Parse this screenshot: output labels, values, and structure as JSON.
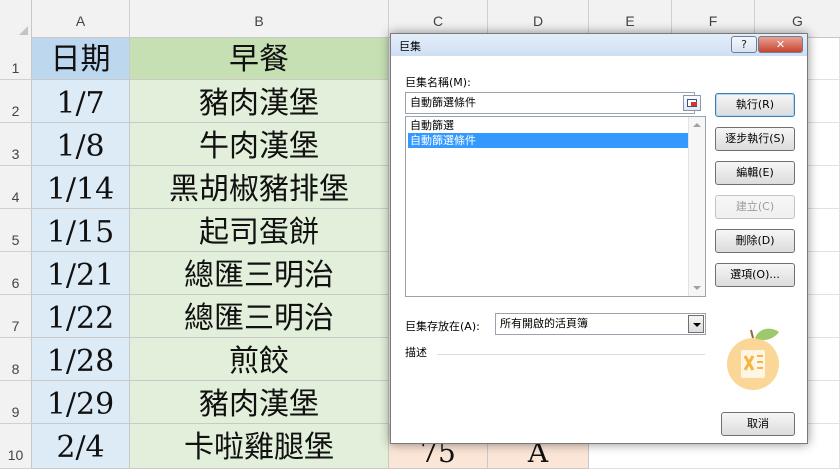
{
  "sheet": {
    "columns": [
      "A",
      "B",
      "C",
      "D",
      "E",
      "F",
      "G"
    ],
    "row_numbers": [
      "1",
      "2",
      "3",
      "4",
      "5",
      "6",
      "7",
      "8",
      "9",
      "10"
    ],
    "col_a": [
      "日期",
      "1/7",
      "1/8",
      "1/14",
      "1/15",
      "1/21",
      "1/22",
      "1/28",
      "1/29",
      "2/4"
    ],
    "col_b": [
      "早餐",
      "豬肉漢堡",
      "牛肉漢堡",
      "黑胡椒豬排堡",
      "起司蛋餅",
      "總匯三明治",
      "總匯三明治",
      "煎餃",
      "豬肉漢堡",
      "卡啦雞腿堡"
    ],
    "bottom_c": "75",
    "bottom_d": "A"
  },
  "dialog": {
    "title": "巨集",
    "help_glyph": "?",
    "close_glyph": "✕",
    "name_label": "巨集名稱(M):",
    "name_value": "自動篩選條件",
    "list_items": [
      "自動篩選",
      "自動篩選條件"
    ],
    "selected_index": 1,
    "buttons": {
      "run": "執行(R)",
      "step": "逐步執行(S)",
      "edit": "編輯(E)",
      "create": "建立(C)",
      "delete": "刪除(D)",
      "options": "選項(O)...",
      "cancel": "取消"
    },
    "store_label": "巨集存放在(A):",
    "store_value": "所有開啟的活頁簿",
    "description_label": "描述"
  },
  "colors": {
    "header_blue": "#bdd7ee",
    "cell_blue": "#ddebf7",
    "header_green": "#c6e0b4",
    "cell_green": "#e2efda",
    "list_selection": "#3399ff",
    "logo_orange": "#f3a22b"
  }
}
